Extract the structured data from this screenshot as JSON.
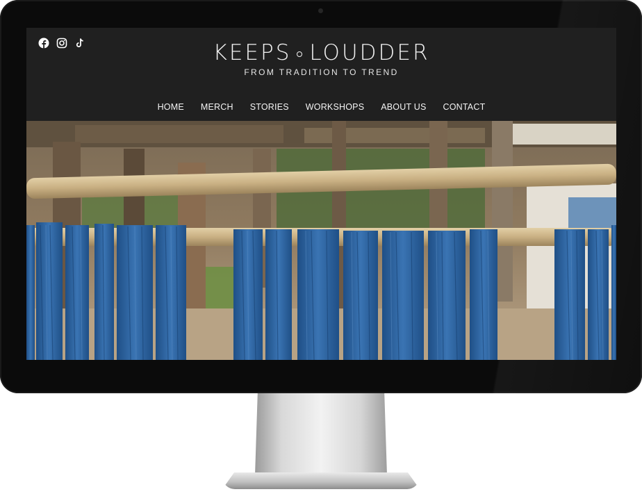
{
  "site": {
    "brand_left": "KEEPS",
    "brand_right": "LOUDDER",
    "tagline": "FROM TRADITION TO TREND"
  },
  "socials": [
    {
      "icon": "facebook-icon"
    },
    {
      "icon": "instagram-icon"
    },
    {
      "icon": "tiktok-icon"
    }
  ],
  "nav": {
    "items": [
      "HOME",
      "MERCH",
      "STORIES",
      "WORKSHOPS",
      "ABOUT US",
      "CONTACT"
    ]
  },
  "colors": {
    "header_bg": "#202020",
    "text": "#f2f2f2",
    "yarn_blue": "#2f63a0",
    "bamboo": "#c9b38a"
  }
}
